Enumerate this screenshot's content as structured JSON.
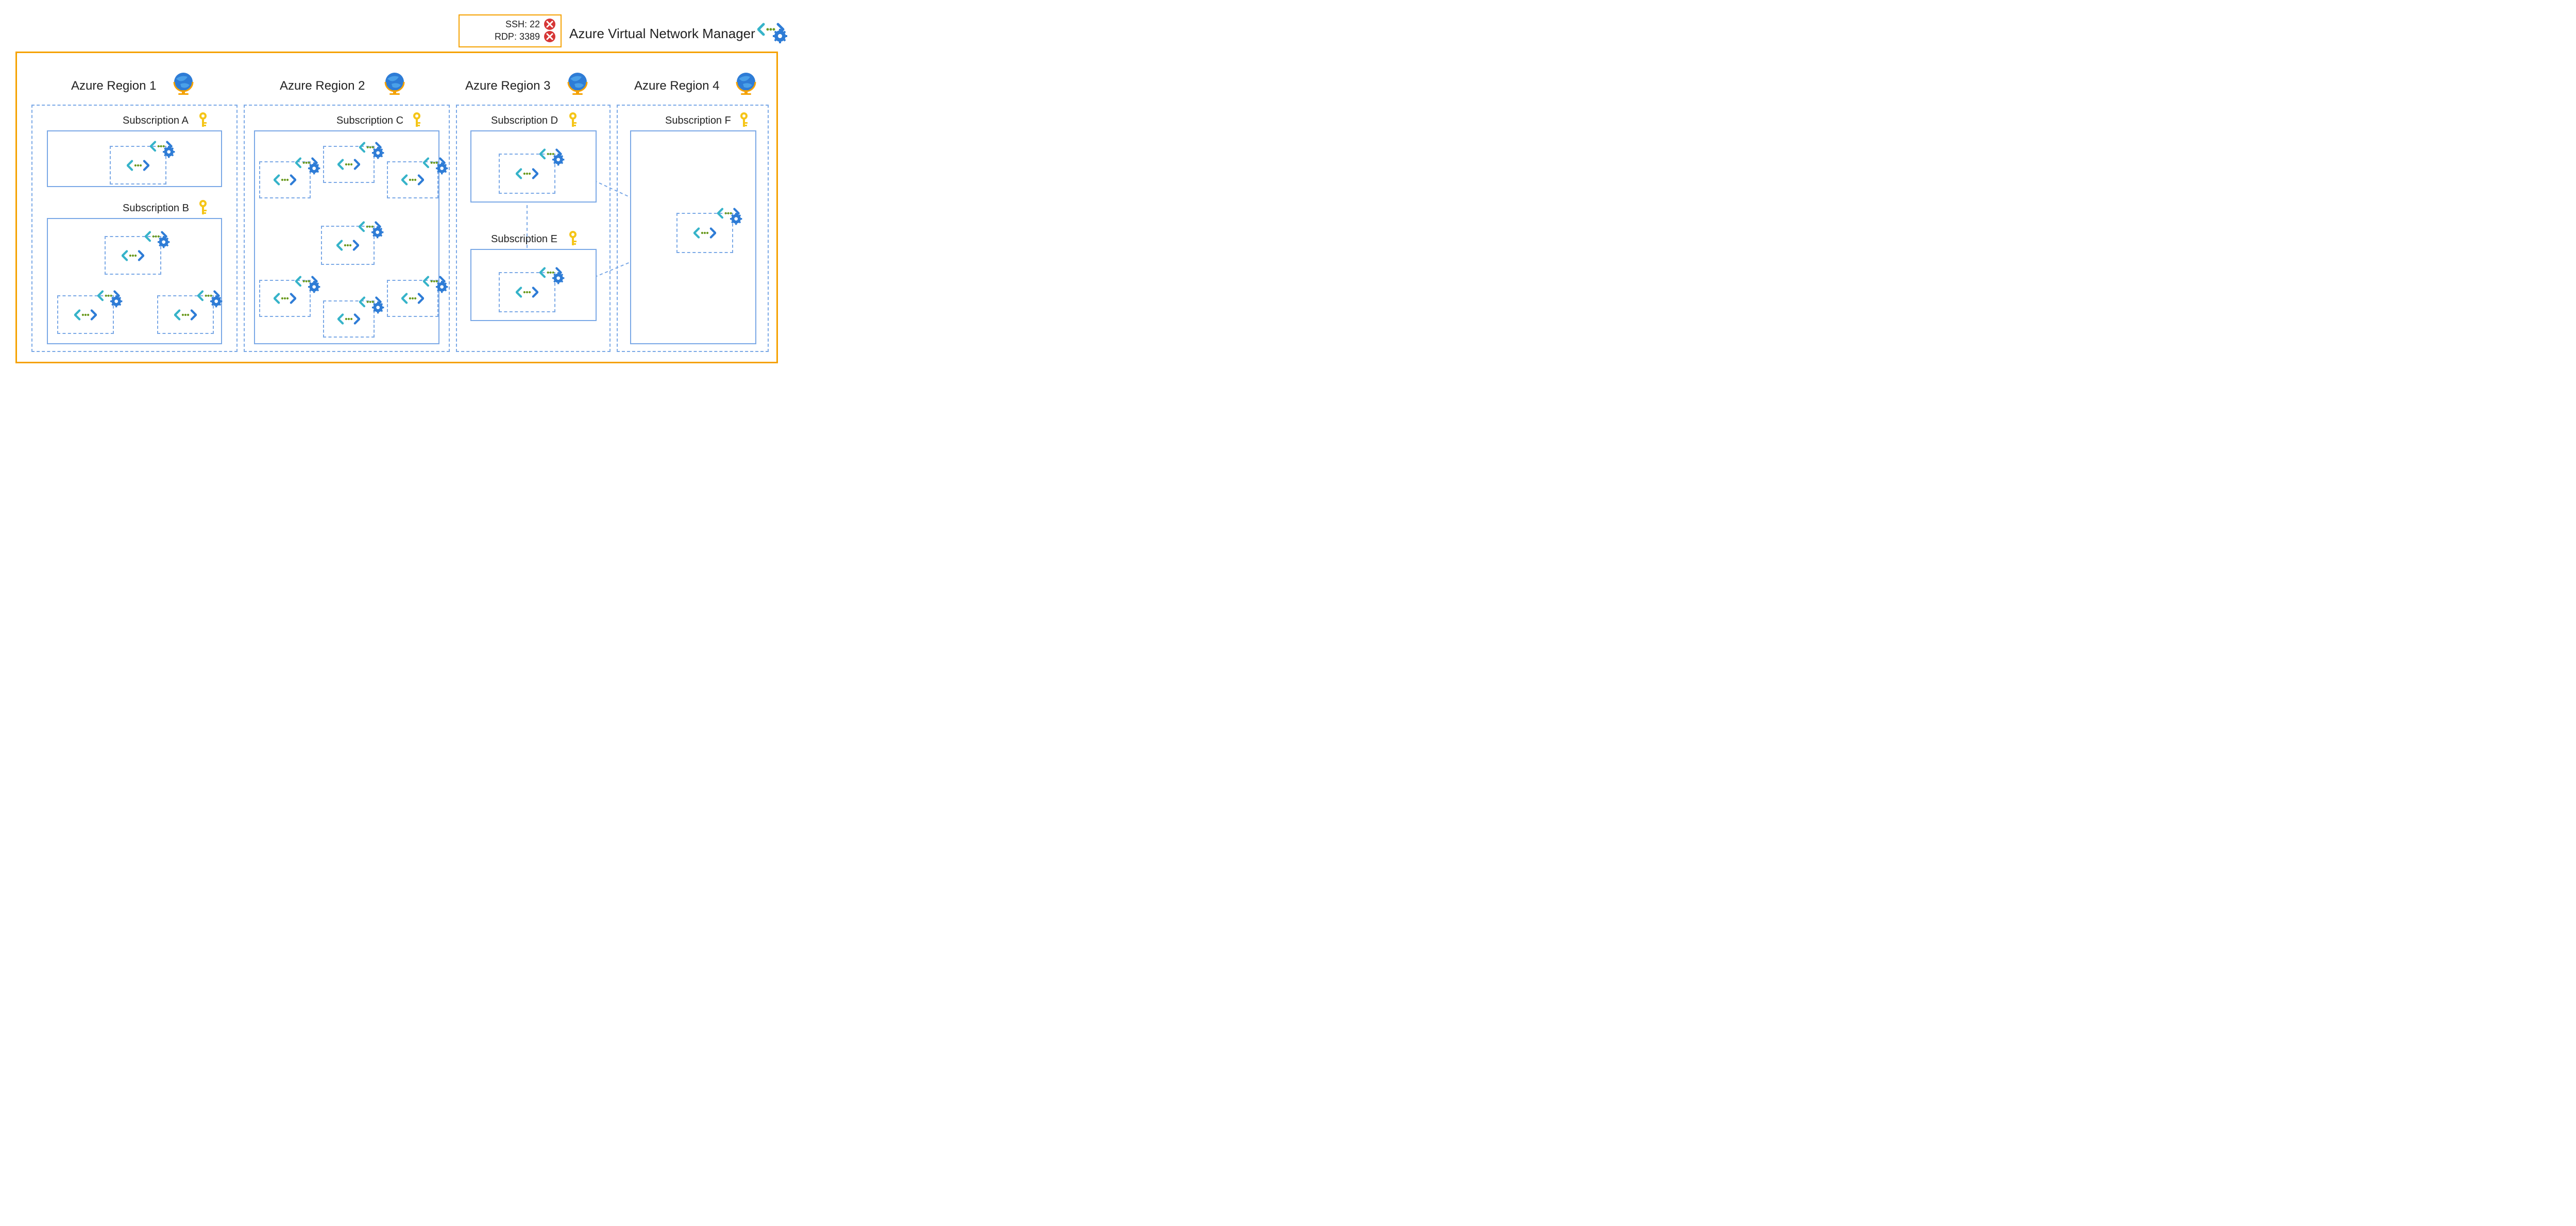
{
  "header": {
    "title": "Azure Virtual Network Manager",
    "rules": {
      "ssh_label": "SSH: 22",
      "rdp_label": "RDP: 3389"
    }
  },
  "regions": [
    {
      "label": "Azure Region 1",
      "subscriptions": [
        "Subscription A",
        "Subscription B"
      ]
    },
    {
      "label": "Azure Region 2",
      "subscriptions": [
        "Subscription C"
      ]
    },
    {
      "label": "Azure Region 3",
      "subscriptions": [
        "Subscription D",
        "Subscription E"
      ]
    },
    {
      "label": "Azure Region 4",
      "subscriptions": [
        "Subscription F"
      ]
    }
  ],
  "subscription_labels": {
    "a": "Subscription A",
    "b": "Subscription B",
    "c": "Subscription C",
    "d": "Subscription D",
    "e": "Subscription E",
    "f": "Subscription F"
  },
  "colors": {
    "accent_orange": "#f5a100",
    "dash_blue": "#7aa8e6",
    "gear_blue": "#2e7cd6",
    "deny_red": "#d63636",
    "teal": "#32c4c4",
    "green_dot": "#6a9a1f"
  }
}
